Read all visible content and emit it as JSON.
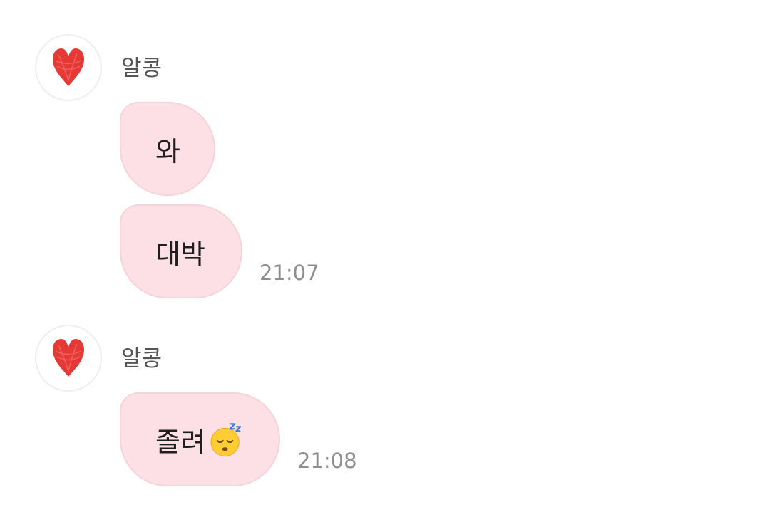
{
  "messages": [
    {
      "sender": "알콩",
      "bubbles": [
        "와",
        "대박"
      ],
      "time": "21:07"
    },
    {
      "sender": "알콩",
      "bubbles": [
        "졸려"
      ],
      "time": "21:08"
    }
  ],
  "icons": {
    "avatar": "red-heart-icon",
    "emoji": "sleeping-face-icon"
  },
  "colors": {
    "bubble_bg": "#fde0e5",
    "heart": "#e53935",
    "time_text": "#8e8e8e"
  }
}
